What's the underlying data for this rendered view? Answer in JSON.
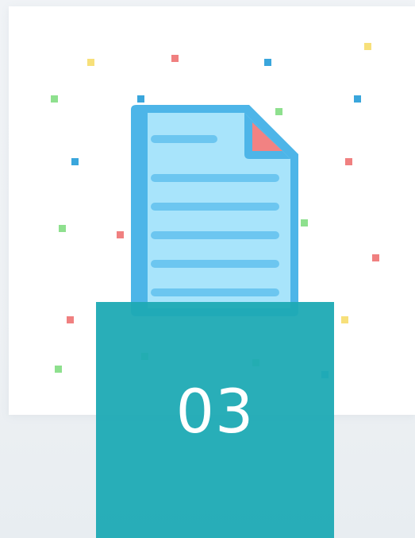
{
  "step": {
    "number": "03"
  },
  "icons": {
    "document": "document-icon",
    "confetti": "confetti-decoration"
  },
  "colors": {
    "accent": "#22adb8",
    "document_fill": "#a8e4fb",
    "document_border": "#4db5e8",
    "document_lines": "#6cc6f0",
    "corner_fold": "#f28282",
    "confetti_red": "#f08080",
    "confetti_green": "#8ee08e",
    "confetti_blue": "#3aa6dc",
    "confetti_yellow": "#f7e07a"
  }
}
